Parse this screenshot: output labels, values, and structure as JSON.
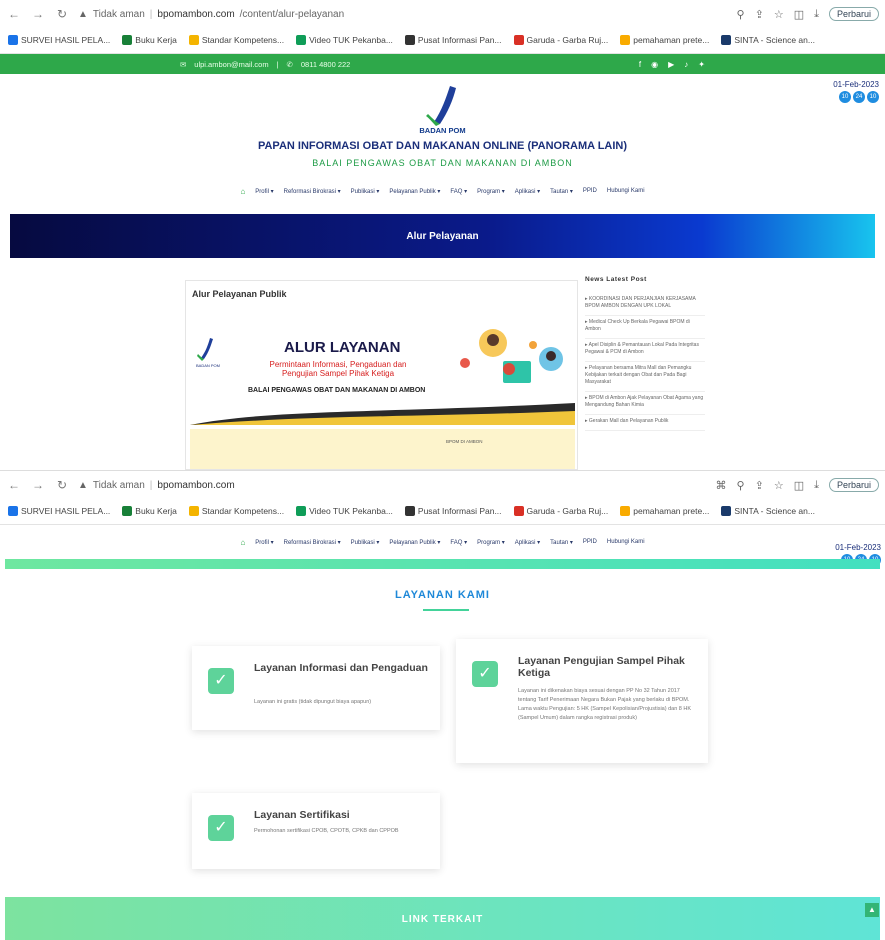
{
  "shot1": {
    "browser": {
      "warning": "Tidak aman",
      "url_host": "bpomambon.com",
      "url_path": "/content/alur-pelayanan",
      "profile": "Perbarui",
      "bookmarks": [
        {
          "label": "SURVEI HASIL PELA...",
          "color": "#1a73e8"
        },
        {
          "label": "Buku Kerja",
          "color": "#188038"
        },
        {
          "label": "Standar Kompetens...",
          "color": "#f4b400"
        },
        {
          "label": "Video TUK Pekanba...",
          "color": "#0f9d58"
        },
        {
          "label": "Pusat Informasi Pan...",
          "color": "#333333"
        },
        {
          "label": "Garuda - Garba Ruj...",
          "color": "#d93025"
        },
        {
          "label": "pemahaman prete...",
          "color": "#f9ab00"
        },
        {
          "label": "SINTA - Science an...",
          "color": "#1a3a6a"
        }
      ]
    },
    "topbar": {
      "email": "ulpi.ambon@mail.com",
      "phone": "0811 4800 222"
    },
    "header": {
      "brand": "BADAN POM",
      "title": "PAPAN INFORMASI OBAT DAN MAKANAN ONLINE (PANORAMA LAIN)",
      "subtitle": "BALAI PENGAWAS OBAT DAN MAKANAN DI AMBON",
      "date": "01-Feb-2023",
      "dots": [
        "10",
        "24",
        "10"
      ]
    },
    "menu": [
      "Profil ▾",
      "Reformasi Birokrasi ▾",
      "Publikasi ▾",
      "Pelayanan Publik ▾",
      "FAQ ▾",
      "Program ▾",
      "Aplikasi ▾",
      "Tautan ▾",
      "PPID",
      "Hubungi Kami"
    ],
    "banner": "Alur Pelayanan",
    "card_title": "Alur Pelayanan Publik",
    "poster": {
      "title": "ALUR LAYANAN",
      "subtitle": "Permintaan Informasi, Pengaduan dan Pengujian Sampel Pihak Ketiga",
      "org": "BALAI PENGAWAS OBAT DAN MAKANAN DI AMBON",
      "footer_mark": "BPOM DI AMBON"
    },
    "sidebar": {
      "title": "News Latest Post",
      "items": [
        "KOORDINASI DAN PERJANJIAN KERJASAMA BPOM AMBON DENGAN UPK LOKAL",
        "Medical Check Up Berkala Pegawai BPOM di Ambon",
        "Apel Disiplin & Pemantauan Lokal Pada Integritas Pegawai & PCM di Ambon",
        "Pelayanan bersama Mitra Mall dan Pemangku Kebijakan terkait dengan Obat dan Pada Bagi Masyarakat",
        "BPOM di Ambon Ajak Pelayanan Obat Agama yang Mengandung Bahan Kimia",
        "Gerakan Mall dan Pelayanan Publik"
      ]
    }
  },
  "shot2": {
    "browser": {
      "warning": "Tidak aman",
      "url_host": "bpomambon.com",
      "url_path": "",
      "profile": "Perbarui"
    },
    "date": "01-Feb-2023",
    "dots": [
      "10",
      "24",
      "10"
    ],
    "section_title": "LAYANAN KAMI",
    "services": [
      {
        "title": "Layanan Informasi dan Pengaduan",
        "desc": "Layanan ini gratis (tidak dipungut biaya apapun)"
      },
      {
        "title": "Layanan Pengujian Sampel Pihak Ketiga",
        "desc": "Layanan ini dikenakan biaya sesuai dengan PP No 32 Tahun 2017 tentang Tarif Penerimaan Negara Bukan Pajak yang berlaku di BPOM. Lama waktu Pengujian: 5 HK (Sampel Kepolisian/Projustisia) dan 8 HK (Sampel Umum) dalam rangka registrasi produk)"
      },
      {
        "title": "Layanan Sertifikasi",
        "desc": "Permohonan sertifikasi CPOB, CPOTB, CPKB dan CPPOB"
      }
    ],
    "link_bar": "LINK TERKAIT"
  }
}
